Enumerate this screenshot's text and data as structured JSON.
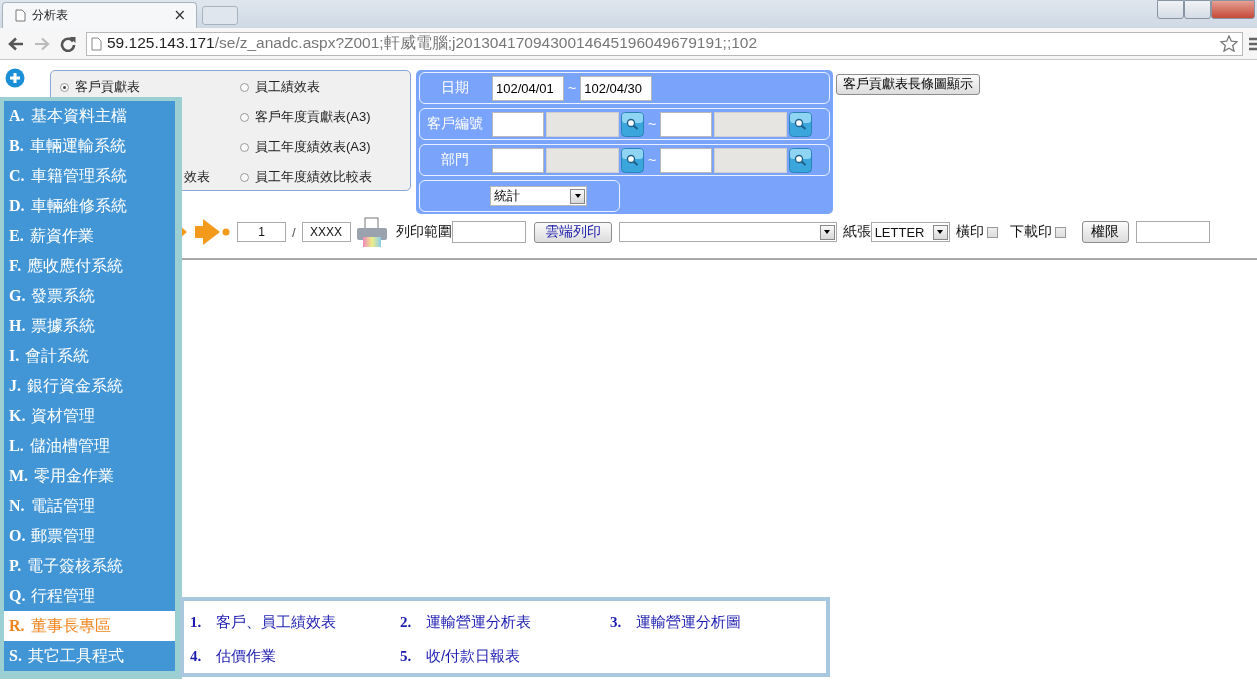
{
  "browser": {
    "tab_title": "分析表",
    "tab_close": "×",
    "url_host": "59.125.143.171",
    "url_path": "/se/z_anadc.aspx?Z001;軒威電腦;j2013041709430014645196049679191;;102"
  },
  "report_types": [
    {
      "kind": "radio",
      "label": "客戶貢獻表",
      "selected": true
    },
    {
      "kind": "radio",
      "label": "員工績效表",
      "selected": false
    },
    {
      "kind": "hidden"
    },
    {
      "kind": "radio",
      "label": "客戶年度貢獻表(A3)",
      "selected": false
    },
    {
      "kind": "hidden"
    },
    {
      "kind": "radio",
      "label": "員工年度績效表(A3)",
      "selected": false
    },
    {
      "kind": "cut",
      "label": "效表"
    },
    {
      "kind": "radio",
      "label": "員工年度績效比較表",
      "selected": false
    }
  ],
  "filters": [
    {
      "kind": "date",
      "label": "日期",
      "from": "102/04/01",
      "separator": "~",
      "to": "102/04/30"
    },
    {
      "kind": "lookup",
      "label": "客戶編號",
      "separator": "~"
    },
    {
      "kind": "lookup",
      "label": "部門",
      "separator": "~"
    },
    {
      "kind": "select",
      "value": "統計"
    }
  ],
  "chart_button": "客戶貢獻表長條圖顯示",
  "toolbar": {
    "page": "1",
    "slash": "/",
    "total": "XXXX",
    "print_range_label": "列印範圍",
    "cloud_print": "雲端列印",
    "paper_label": "紙張",
    "paper": "LETTER",
    "options": [
      {
        "label": "橫印",
        "checked": false
      },
      {
        "label": "下載印",
        "checked": false
      }
    ],
    "permission_button": "權限"
  },
  "sidebar": {
    "items": [
      {
        "letter": "A.",
        "label": "基本資料主檔",
        "selected": false
      },
      {
        "letter": "B.",
        "label": "車輛運輸系統",
        "selected": false
      },
      {
        "letter": "C.",
        "label": "車籍管理系統",
        "selected": false
      },
      {
        "letter": "D.",
        "label": "車輛維修系統",
        "selected": false
      },
      {
        "letter": "E.",
        "label": "薪資作業",
        "selected": false
      },
      {
        "letter": "F.",
        "label": "應收應付系統",
        "selected": false
      },
      {
        "letter": "G.",
        "label": "發票系統",
        "selected": false
      },
      {
        "letter": "H.",
        "label": "票據系統",
        "selected": false
      },
      {
        "letter": "I.",
        "label": "會計系統",
        "selected": false
      },
      {
        "letter": "J.",
        "label": "銀行資金系統",
        "selected": false
      },
      {
        "letter": "K.",
        "label": "資材管理",
        "selected": false
      },
      {
        "letter": "L.",
        "label": "儲油槽管理",
        "selected": false
      },
      {
        "letter": "M.",
        "label": "零用金作業",
        "selected": false
      },
      {
        "letter": "N.",
        "label": "電話管理",
        "selected": false
      },
      {
        "letter": "O.",
        "label": "郵票管理",
        "selected": false
      },
      {
        "letter": "P.",
        "label": "電子簽核系統",
        "selected": false
      },
      {
        "letter": "Q.",
        "label": "行程管理",
        "selected": false
      },
      {
        "letter": "R.",
        "label": "董事長專區",
        "selected": true
      },
      {
        "letter": "S.",
        "label": "其它工具程式",
        "selected": false
      }
    ]
  },
  "submenu": [
    {
      "number": "1.",
      "label": "客戶、員工績效表"
    },
    {
      "number": "2.",
      "label": "運輸營運分析表"
    },
    {
      "number": "3.",
      "label": "運輸營運分析圖"
    },
    {
      "number": "4.",
      "label": "估價作業"
    },
    {
      "number": "5.",
      "label": "收/付款日報表"
    }
  ]
}
